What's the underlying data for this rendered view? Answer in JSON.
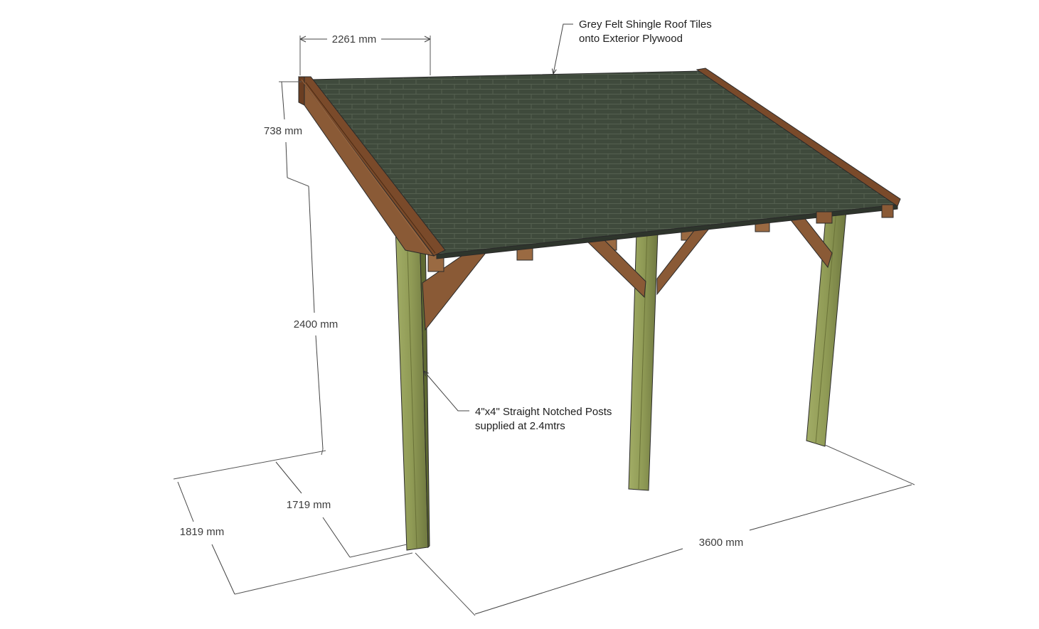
{
  "dimensions": {
    "roof_overhang": "2261 mm",
    "roof_rise": "738 mm",
    "post_height": "2400 mm",
    "inner_depth": "1719 mm",
    "outer_depth": "1819 mm",
    "length": "3600 mm"
  },
  "notes": {
    "roof_line1": "Grey Felt Shingle Roof Tiles",
    "roof_line2": "onto Exterior Plywood",
    "post_line1": "4\"x4\" Straight Notched Posts",
    "post_line2": "supplied at 2.4mtrs"
  },
  "colors": {
    "roof_shingle": "#3f4a3c",
    "roof_shingle_line": "#5b6657",
    "fascia": "#7a4a2a",
    "bracket": "#8a5a36",
    "post": "#8f9a55"
  }
}
